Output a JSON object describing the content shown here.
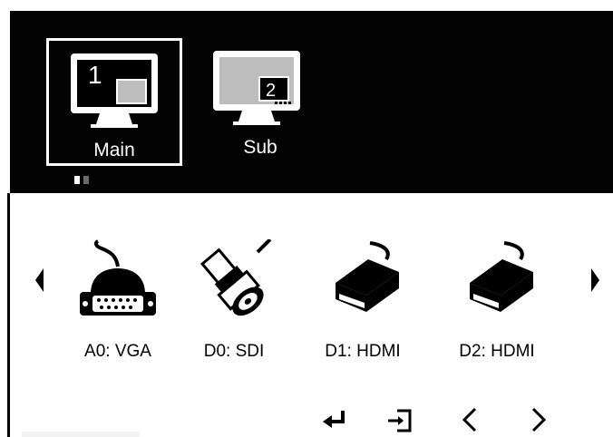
{
  "outputs": [
    {
      "label": "Main",
      "number": "1",
      "selected": true
    },
    {
      "label": "Sub",
      "number": "2",
      "selected": false
    }
  ],
  "page_indicator": {
    "count": 2,
    "active": 0
  },
  "sources": [
    {
      "label": "A0: VGA",
      "icon": "vga-connector-icon"
    },
    {
      "label": "D0: SDI",
      "icon": "bnc-connector-icon"
    },
    {
      "label": "D1: HDMI",
      "icon": "hdmi-connector-icon"
    },
    {
      "label": "D2: HDMI",
      "icon": "hdmi-connector-icon"
    }
  ],
  "nav": {
    "prev_icon": "triangle-left-icon",
    "next_icon": "triangle-right-icon"
  },
  "bottom_buttons": [
    "enter-icon",
    "exit-icon",
    "chevron-left-icon",
    "chevron-right-icon"
  ],
  "colors": {
    "panel": "#030303",
    "highlight": "#ffffff",
    "thumb": "#cfcfcf"
  }
}
